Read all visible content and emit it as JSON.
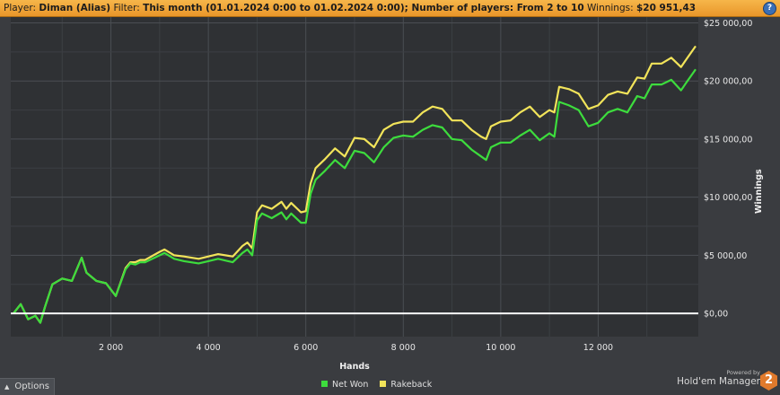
{
  "header": {
    "player_label": "Player:",
    "player_value": "Diman (Alias)",
    "filter_label": "Filter:",
    "filter_value": "This month (01.01.2024 0:00 to 01.02.2024 0:00); Number of players: From 2 to 10",
    "winnings_label": "Winnings:",
    "winnings_value": "$20 951,43",
    "help_glyph": "?"
  },
  "chart_data": {
    "type": "line",
    "xlabel": "Hands",
    "ylabel": "Winnings",
    "xlim": [
      0,
      14000
    ],
    "ylim": [
      -2000,
      25500
    ],
    "x_ticks": [
      2000,
      4000,
      6000,
      8000,
      10000,
      12000
    ],
    "x_tick_labels": [
      "2 000",
      "4 000",
      "6 000",
      "8 000",
      "10 000",
      "12 000"
    ],
    "y_ticks": [
      0,
      5000,
      10000,
      15000,
      20000,
      25000
    ],
    "y_tick_labels": [
      "$0,00",
      "$5 000,00",
      "$10 000,00",
      "$15 000,00",
      "$20 000,00",
      "$25 000,00"
    ],
    "grid": true,
    "legend_position": "bottom",
    "x": [
      0,
      150,
      300,
      450,
      550,
      650,
      800,
      1000,
      1200,
      1400,
      1500,
      1700,
      1900,
      2100,
      2300,
      2400,
      2500,
      2600,
      2700,
      3000,
      3100,
      3300,
      3500,
      3800,
      4000,
      4200,
      4500,
      4700,
      4800,
      4900,
      5000,
      5100,
      5300,
      5500,
      5600,
      5700,
      5900,
      6000,
      6100,
      6200,
      6400,
      6600,
      6800,
      7000,
      7200,
      7400,
      7600,
      7800,
      8000,
      8200,
      8400,
      8600,
      8800,
      9000,
      9200,
      9400,
      9600,
      9700,
      9800,
      10000,
      10200,
      10400,
      10600,
      10800,
      11000,
      11100,
      11200,
      11400,
      11600,
      11800,
      12000,
      12200,
      12400,
      12600,
      12800,
      12950,
      13100,
      13300,
      13500,
      13700,
      13800,
      14000
    ],
    "series": [
      {
        "name": "Net Won",
        "color": "#3ddc3d",
        "values": [
          0,
          800,
          -500,
          -200,
          -800,
          600,
          2500,
          3000,
          2800,
          4800,
          3500,
          2800,
          2600,
          1500,
          3800,
          4300,
          4200,
          4400,
          4400,
          5000,
          5200,
          4700,
          4500,
          4300,
          4500,
          4700,
          4400,
          5200,
          5500,
          5000,
          8000,
          8600,
          8200,
          8700,
          8100,
          8600,
          7800,
          7800,
          10300,
          11500,
          12300,
          13200,
          12500,
          14000,
          13800,
          13000,
          14300,
          15100,
          15300,
          15200,
          15800,
          16200,
          16000,
          15000,
          14900,
          14100,
          13500,
          13200,
          14300,
          14700,
          14700,
          15300,
          15800,
          14900,
          15500,
          15200,
          18200,
          17900,
          17500,
          16100,
          16400,
          17300,
          17600,
          17300,
          18700,
          18500,
          19700,
          19700,
          20100,
          19200,
          19800,
          21000
        ]
      },
      {
        "name": "Rakeback",
        "color": "#f2e45a",
        "values": [
          0,
          800,
          -500,
          -200,
          -800,
          600,
          2500,
          3000,
          2800,
          4800,
          3500,
          2800,
          2600,
          1500,
          3900,
          4400,
          4400,
          4600,
          4600,
          5300,
          5500,
          5000,
          4900,
          4700,
          4900,
          5100,
          4900,
          5800,
          6100,
          5600,
          8700,
          9300,
          9000,
          9600,
          9000,
          9500,
          8700,
          8800,
          11200,
          12500,
          13300,
          14200,
          13500,
          15100,
          15000,
          14300,
          15800,
          16300,
          16500,
          16500,
          17300,
          17800,
          17600,
          16600,
          16600,
          15800,
          15200,
          15000,
          16100,
          16500,
          16600,
          17300,
          17800,
          16900,
          17500,
          17300,
          19500,
          19300,
          18900,
          17600,
          17900,
          18800,
          19100,
          18900,
          20300,
          20200,
          21500,
          21500,
          22000,
          21200,
          21800,
          23000
        ]
      }
    ]
  },
  "legend": {
    "items": [
      {
        "label": "Net Won",
        "color": "#3ddc3d"
      },
      {
        "label": "Rakeback",
        "color": "#f2e45a"
      }
    ]
  },
  "footer": {
    "options_label": "Options",
    "options_arrow": "▲",
    "powered_by": "Powered by",
    "brand_name": "Hold'em Manager",
    "brand_badge": "2"
  }
}
